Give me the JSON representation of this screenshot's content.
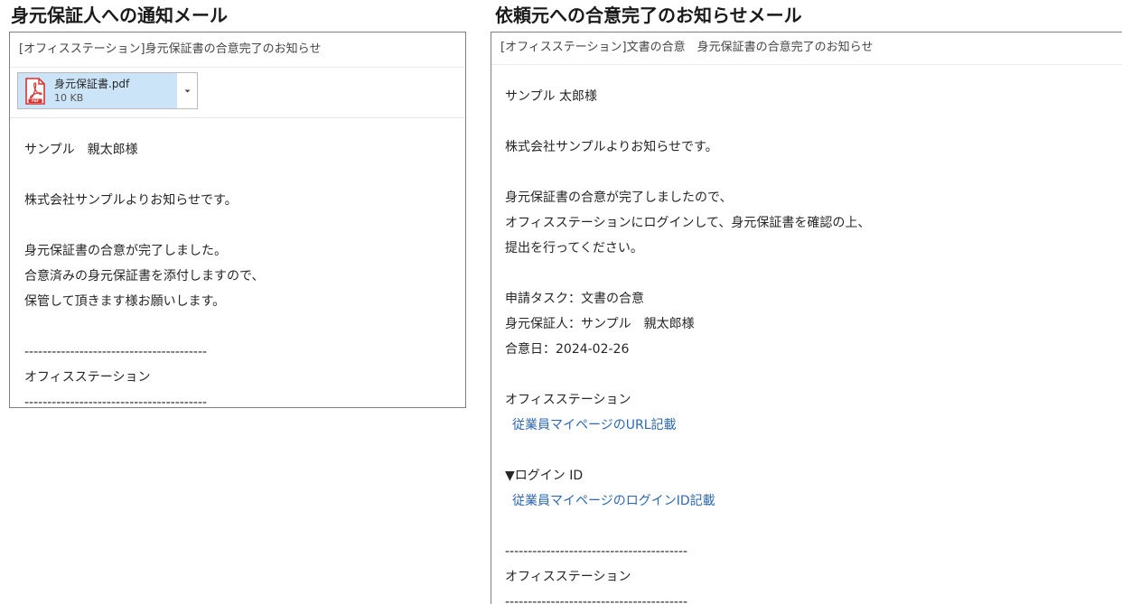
{
  "left_section": {
    "heading": "身元保証人への通知メール",
    "subject": "[オフィスステーション]身元保証書の合意完了のお知らせ",
    "attachment": {
      "icon": "pdf-file-icon",
      "filename": "身元保証書.pdf",
      "size": "10 KB"
    },
    "body": {
      "greeting": "サンプル　親太郎様",
      "intro": "株式会社サンプルよりお知らせです。",
      "message_1": "身元保証書の合意が完了しました。",
      "message_2": "合意済みの身元保証書を添付しますので、",
      "message_3": "保管して頂きます様お願いします。",
      "separator_top": "----------------------------------------",
      "signature": "オフィスステーション",
      "separator_bottom": "----------------------------------------"
    }
  },
  "right_section": {
    "heading": "依頼元への合意完了のお知らせメール",
    "subject": "[オフィスステーション]文書の合意　身元保証書の合意完了のお知らせ",
    "body": {
      "greeting": "サンプル 太郎様",
      "intro": "株式会社サンプルよりお知らせです。",
      "message_1": "身元保証書の合意が完了しましたので、",
      "message_2": "オフィスステーションにログインして、身元保証書を確認の上、",
      "message_3": "提出を行ってください。",
      "task": "申請タスク：文書の合意",
      "guarantor": "身元保証人：サンプル　親太郎様",
      "agreed_date": "合意日：2024-02-26",
      "service_name": "オフィスステーション",
      "mypage_url_link": "従業員マイページのURL記載",
      "login_id_label": "▼ログイン ID",
      "login_id_link": "従業員マイページのログインID記載",
      "separator_top": "----------------------------------------",
      "signature": "オフィスステーション",
      "separator_bottom": "----------------------------------------"
    }
  },
  "colors": {
    "link": "#2e68b1",
    "attachment_bg": "#cce4f7",
    "pdf_red": "#d9322f",
    "panel_border": "#7f7f7f"
  }
}
